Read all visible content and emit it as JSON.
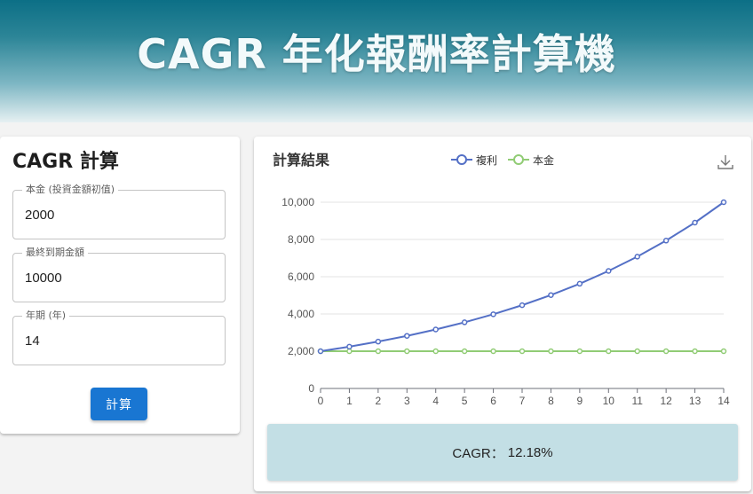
{
  "header": {
    "title": "CAGR 年化報酬率計算機"
  },
  "calculator": {
    "heading": "CAGR 計算",
    "principal": {
      "label": "本金 (投資金額初值)",
      "value": "2000"
    },
    "final_amount": {
      "label": "最終到期金額",
      "value": "10000"
    },
    "years": {
      "label": "年期 (年)",
      "value": "14"
    },
    "submit_label": "計算"
  },
  "results": {
    "heading": "計算結果",
    "download_icon": "download-icon",
    "cagr_label": "CAGR：",
    "cagr_value": "12.18%"
  },
  "colors": {
    "accent": "#1976d2",
    "compound_series": "#5470c6",
    "principal_series": "#91cc75",
    "result_box": "#c3dfe5"
  },
  "chart_data": {
    "type": "line",
    "x": [
      0,
      1,
      2,
      3,
      4,
      5,
      6,
      7,
      8,
      9,
      10,
      11,
      12,
      13,
      14
    ],
    "series": [
      {
        "name": "複利",
        "color": "#5470c6",
        "values": [
          2000,
          2244,
          2517,
          2823,
          3167,
          3552,
          3985,
          4470,
          5014,
          5624,
          6309,
          7077,
          7939,
          8905,
          10000
        ]
      },
      {
        "name": "本金",
        "color": "#91cc75",
        "values": [
          2000,
          2000,
          2000,
          2000,
          2000,
          2000,
          2000,
          2000,
          2000,
          2000,
          2000,
          2000,
          2000,
          2000,
          2000
        ]
      }
    ],
    "y_ticks": [
      "0",
      "2,000",
      "4,000",
      "6,000",
      "8,000",
      "10,000"
    ],
    "x_ticks": [
      "0",
      "1",
      "2",
      "3",
      "4",
      "5",
      "6",
      "7",
      "8",
      "9",
      "10",
      "11",
      "12",
      "13",
      "14"
    ],
    "ylim": [
      0,
      10000
    ],
    "xlim": [
      0,
      14
    ],
    "legend_position": "top-center",
    "grid": true
  }
}
